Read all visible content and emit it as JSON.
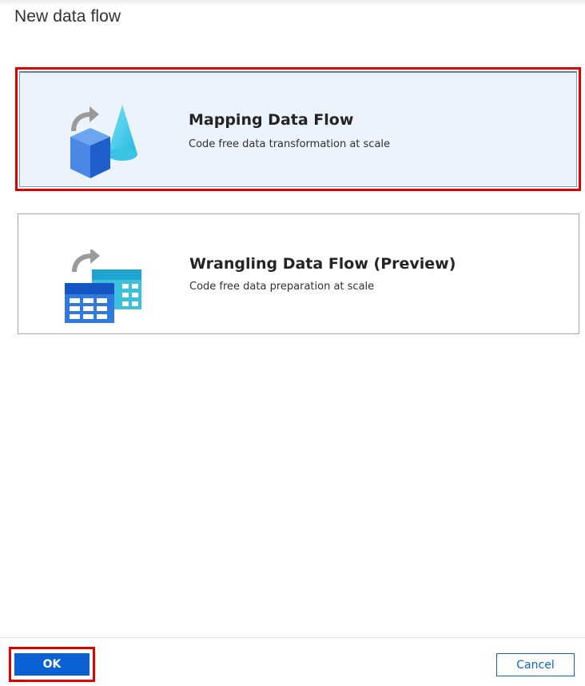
{
  "dialog": {
    "title": "New data flow"
  },
  "options": [
    {
      "title": "Mapping Data Flow",
      "description": "Code free data transformation at scale",
      "icon": "mapping-data-flow-icon",
      "selected": true
    },
    {
      "title": "Wrangling Data Flow (Preview)",
      "description": "Code free data preparation at scale",
      "icon": "wrangling-data-flow-icon",
      "selected": false
    }
  ],
  "footer": {
    "ok_label": "OK",
    "cancel_label": "Cancel"
  },
  "colors": {
    "accent": "#0a61d4",
    "highlight": "#e00000",
    "selected_bg": "#ebf3fc"
  }
}
